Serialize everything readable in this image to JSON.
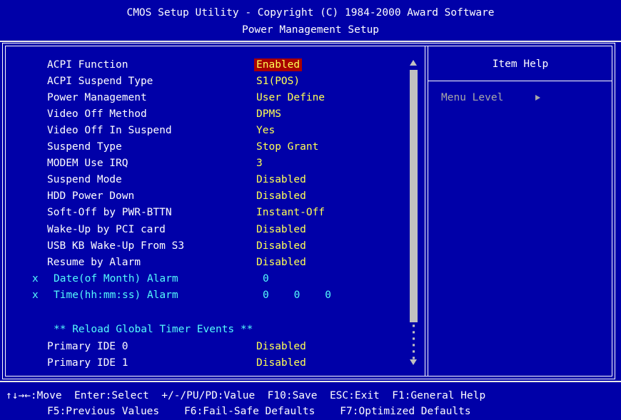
{
  "header": {
    "title": "CMOS Setup Utility - Copyright (C) 1984-2000 Award Software",
    "subtitle": "Power Management Setup"
  },
  "items": [
    {
      "label": "ACPI Function",
      "value": "Enabled"
    },
    {
      "label": "ACPI Suspend Type",
      "value": "S1(POS)"
    },
    {
      "label": "Power Management",
      "value": "User Define"
    },
    {
      "label": "Video Off Method",
      "value": "DPMS"
    },
    {
      "label": "Video Off In Suspend",
      "value": "Yes"
    },
    {
      "label": "Suspend Type",
      "value": "Stop Grant"
    },
    {
      "label": "MODEM Use IRQ",
      "value": "3"
    },
    {
      "label": "Suspend Mode",
      "value": "Disabled"
    },
    {
      "label": "HDD Power Down",
      "value": "Disabled"
    },
    {
      "label": "Soft-Off by PWR-BTTN",
      "value": "Instant-Off"
    },
    {
      "label": "Wake-Up by PCI card",
      "value": "Disabled"
    },
    {
      "label": "USB KB Wake-Up From S3",
      "value": "Disabled"
    },
    {
      "label": "Resume by Alarm",
      "value": "Disabled"
    },
    {
      "prefix": "x",
      "label": "Date(of Month) Alarm",
      "value": "0"
    },
    {
      "prefix": "x",
      "label": "Time(hh:mm:ss) Alarm",
      "value": "0    0    0"
    },
    {
      "label": "** Reload Global Timer Events **"
    },
    {
      "label": "Primary IDE 0",
      "value": "Disabled"
    },
    {
      "label": "Primary IDE 1",
      "value": "Disabled"
    }
  ],
  "help": {
    "title": "Item Help",
    "menu_level": "Menu Level"
  },
  "footer": {
    "line1": "↑↓→←:Move  Enter:Select  +/-/PU/PD:Value  F10:Save  ESC:Exit  F1:General Help",
    "line2": "F5:Previous Values    F6:Fail-Safe Defaults    F7:Optimized Defaults"
  },
  "colors": {
    "background": "#0000a8",
    "label": "#ffffff",
    "value": "#ffff54",
    "disabled_item": "#54fcfc",
    "highlight": "#a80000"
  }
}
